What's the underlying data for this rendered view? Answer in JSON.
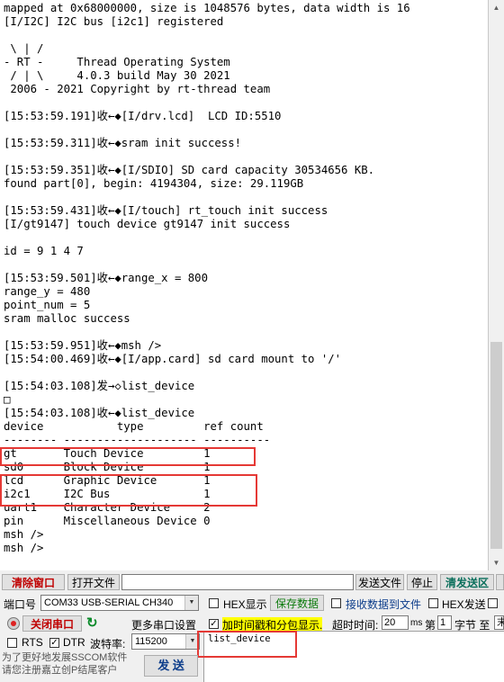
{
  "terminal": {
    "lines": [
      "mapped at 0x68000000, size is 1048576 bytes, data width is 16",
      "[I/I2C] I2C bus [i2c1] registered",
      "",
      " \\ | /",
      "- RT -     Thread Operating System",
      " / | \\     4.0.3 build May 30 2021",
      " 2006 - 2021 Copyright by rt-thread team",
      "",
      "[15:53:59.191]收←◆[I/drv.lcd]  LCD ID:5510",
      "",
      "[15:53:59.311]收←◆sram init success!",
      "",
      "[15:53:59.351]收←◆[I/SDIO] SD card capacity 30534656 KB.",
      "found part[0], begin: 4194304, size: 29.119GB",
      "",
      "[15:53:59.431]收←◆[I/touch] rt_touch init success",
      "[I/gt9147] touch device gt9147 init success",
      "",
      "id = 9 1 4 7",
      "",
      "[15:53:59.501]收←◆range_x = 800",
      "range_y = 480",
      "point_num = 5",
      "sram malloc success",
      "",
      "[15:53:59.951]收←◆msh />",
      "[15:54:00.469]收←◆[I/app.card] sd card mount to '/'",
      "",
      "[15:54:03.108]发→◇list_device",
      "□",
      "[15:54:03.108]收←◆list_device",
      "device           type         ref count",
      "-------- -------------------- ----------",
      "gt       Touch Device         1",
      "sd0      Block Device         1",
      "lcd      Graphic Device       1",
      "i2c1     I2C Bus              1",
      "uart1    Character Device     2",
      "pin      Miscellaneous Device 0",
      "msh />",
      "msh />"
    ]
  },
  "toolbar": {
    "clear_window": "清除窗口",
    "open_file": "打开文件",
    "send_file": "发送文件",
    "stop": "停止",
    "clear_send_area": "清发送区"
  },
  "settings": {
    "port_label": "端口号",
    "port_value": "COM33 USB-SERIAL CH340",
    "close_port": "关闭串口",
    "more_settings": "更多串口设置",
    "rts_label": "RTS",
    "dtr_label": "DTR",
    "baud_label": "波特率:",
    "baud_value": "115200",
    "hex_display": "HEX显示",
    "save_data": "保存数据",
    "recv_to_file": "接收数据到文件",
    "hex_send": "HEX发送",
    "timestamp_label": "加时间戳和分包显示.",
    "timeout_label": "超时时间:",
    "timeout_value": "20",
    "timeout_unit": "ms",
    "frame_label": "第",
    "frame_value": "1",
    "byte_label": "字节 至",
    "end_label": "末"
  },
  "send": {
    "text": "list_device",
    "button": "发 送"
  },
  "promo": {
    "line1": "为了更好地发展SSCOM软件",
    "line2": "请您注册嘉立创P结尾客户"
  },
  "colors": {
    "highlight_box": "#e53935",
    "timestamp_bg": "#ffff00",
    "clear_button_text": "#c00000"
  }
}
